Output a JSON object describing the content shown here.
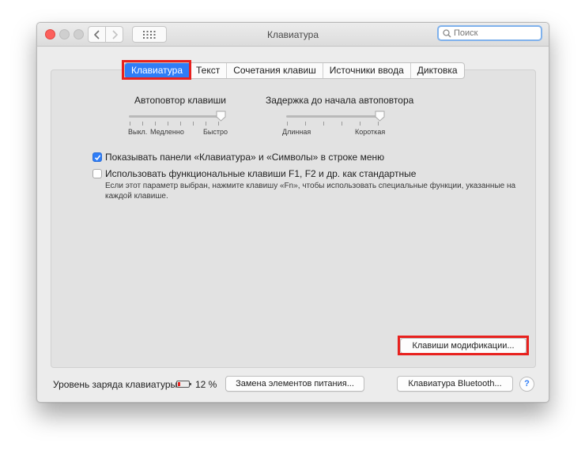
{
  "window": {
    "title": "Клавиатура",
    "search_placeholder": "Поиск"
  },
  "tabs": [
    {
      "label": "Клавиатура",
      "active": true
    },
    {
      "label": "Текст",
      "active": false
    },
    {
      "label": "Сочетания клавиш",
      "active": false
    },
    {
      "label": "Источники ввода",
      "active": false
    },
    {
      "label": "Диктовка",
      "active": false
    }
  ],
  "key_repeat": {
    "label": "Автоповтор клавиши",
    "scale_labels": [
      "Выкл.",
      "Медленно",
      "Быстро"
    ],
    "value_fraction": 1.0
  },
  "repeat_delay": {
    "label": "Задержка до начала автоповтора",
    "scale_labels": [
      "Длинная",
      "Короткая"
    ],
    "value_fraction": 1.0
  },
  "options": [
    {
      "label": "Показывать панели «Клавиатура» и «Символы» в строке меню",
      "checked": true
    },
    {
      "label": "Использовать функциональные клавиши F1, F2 и др. как стандартные",
      "checked": false,
      "note": "Если этот параметр выбран, нажмите клавишу «Fn», чтобы использовать специальные функции, указанные на каждой клавише."
    }
  ],
  "buttons": {
    "modifier_keys": "Клавиши модификации...",
    "replace_power": "Замена элементов питания...",
    "bluetooth_keyboard": "Клавиатура Bluetooth...",
    "help": "?"
  },
  "battery": {
    "label": "Уровень заряда клавиатуры:",
    "percent_text": "12 %",
    "level": 0.12
  },
  "colors": {
    "accent": "#2f7df7",
    "highlight_red": "#e8211e"
  }
}
